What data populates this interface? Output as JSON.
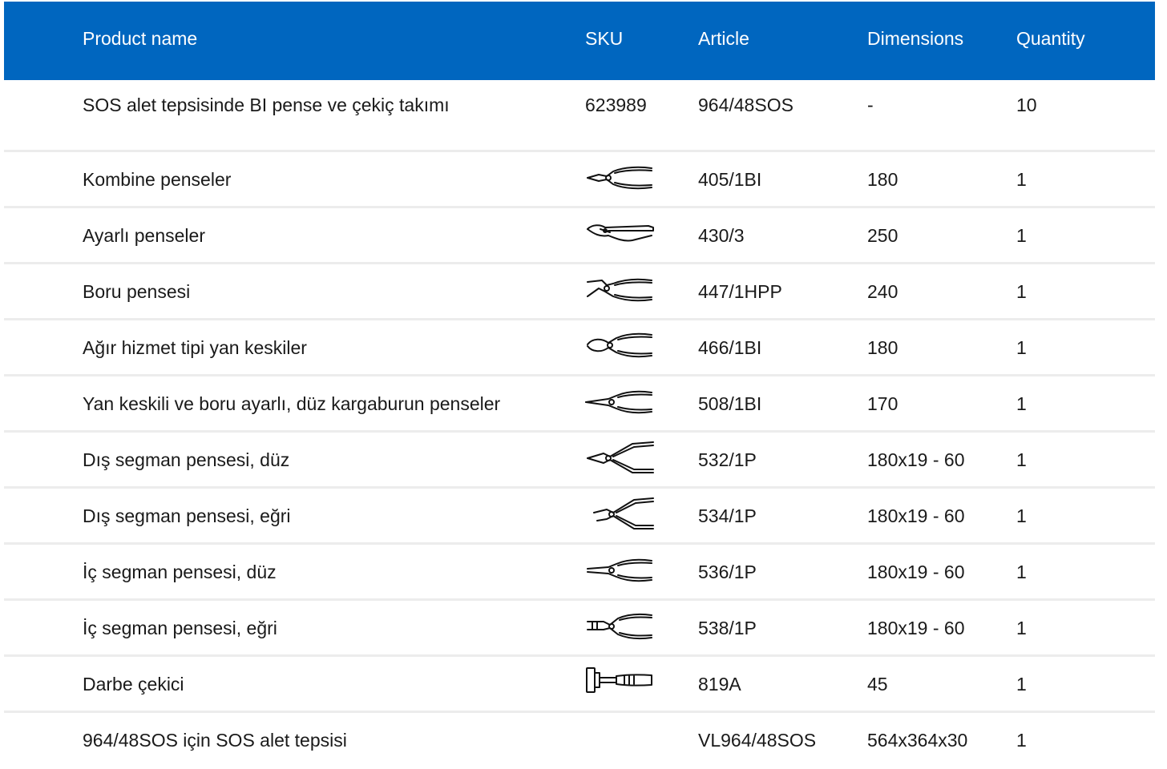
{
  "header": {
    "product_name": "Product name",
    "sku": "SKU",
    "article": "Article",
    "dimensions": "Dimensions",
    "quantity": "Quantity"
  },
  "rows": [
    {
      "name": "SOS alet tepsisinde BI pense ve çekiç takımı",
      "sku": "623989",
      "article": "964/48SOS",
      "dimensions": "-",
      "quantity": "10"
    },
    {
      "name": "Kombine penseler",
      "sku_icon": "combination-pliers-icon",
      "article": "405/1BI",
      "dimensions": "180",
      "quantity": "1"
    },
    {
      "name": "Ayarlı penseler",
      "sku_icon": "locking-pliers-icon",
      "article": "430/3",
      "dimensions": "250",
      "quantity": "1"
    },
    {
      "name": "Boru pensesi",
      "sku_icon": "pipe-pliers-icon",
      "article": "447/1HPP",
      "dimensions": "240",
      "quantity": "1"
    },
    {
      "name": "Ağır hizmet tipi yan keskiler",
      "sku_icon": "side-cutters-icon",
      "article": "466/1BI",
      "dimensions": "180",
      "quantity": "1"
    },
    {
      "name": "Yan keskili ve boru ayarlı, düz kargaburun penseler",
      "sku_icon": "long-nose-pliers-icon",
      "article": "508/1BI",
      "dimensions": "170",
      "quantity": "1"
    },
    {
      "name": "Dış segman pensesi, düz",
      "sku_icon": "circlip-pliers-straight-icon",
      "article": "532/1P",
      "dimensions": "180x19 - 60",
      "quantity": "1"
    },
    {
      "name": "Dış segman pensesi, eğri",
      "sku_icon": "circlip-pliers-bent-icon",
      "article": "534/1P",
      "dimensions": "180x19 - 60",
      "quantity": "1"
    },
    {
      "name": "İç segman pensesi, düz",
      "sku_icon": "internal-circlip-pliers-straight-icon",
      "article": "536/1P",
      "dimensions": "180x19 - 60",
      "quantity": "1"
    },
    {
      "name": "İç segman pensesi, eğri",
      "sku_icon": "internal-circlip-pliers-bent-icon",
      "article": "538/1P",
      "dimensions": "180x19 - 60",
      "quantity": "1"
    },
    {
      "name": "Darbe çekici",
      "sku_icon": "mallet-icon",
      "article": "819A",
      "dimensions": "45",
      "quantity": "1"
    },
    {
      "name": "964/48SOS için SOS alet tepsisi",
      "sku": "",
      "article": "VL964/48SOS",
      "dimensions": "564x364x30",
      "quantity": "1"
    }
  ],
  "colors": {
    "header_bg": "#0066bf",
    "header_text": "#ffffff",
    "row_divider": "#ececec",
    "text": "#1a1a1a"
  }
}
